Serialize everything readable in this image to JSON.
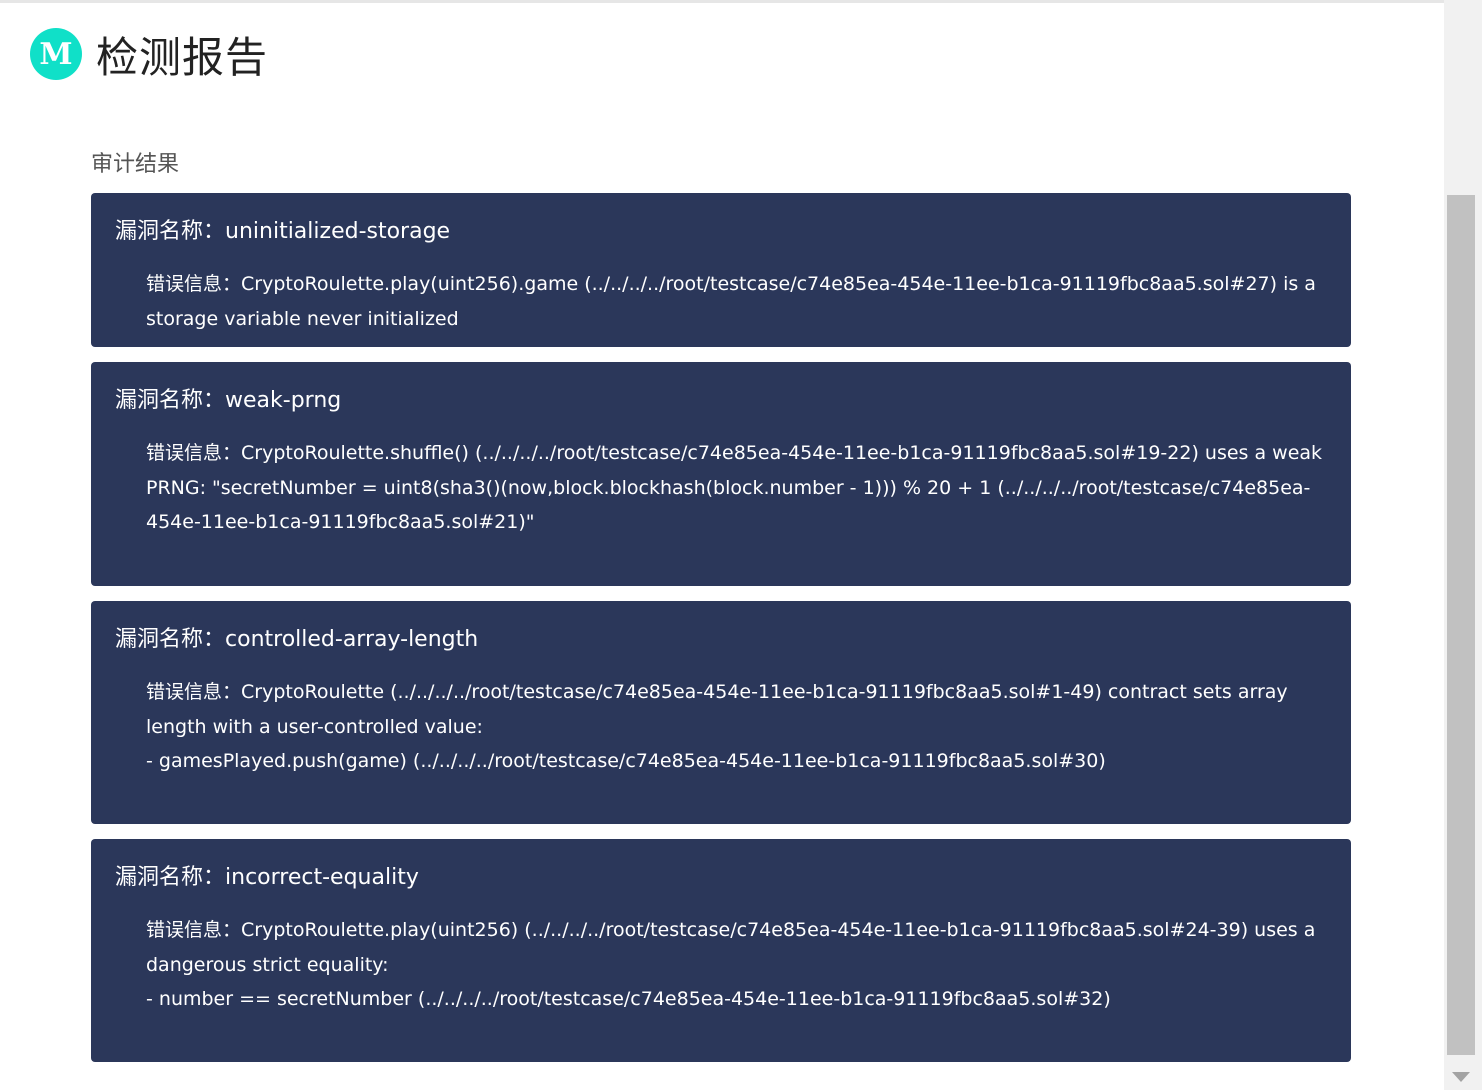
{
  "header": {
    "logo_letter": "M",
    "title": "检测报告"
  },
  "section": {
    "title": "审计结果"
  },
  "vulnerabilities": [
    {
      "name_label": "漏洞名称：",
      "name": "uninitialized-storage",
      "message_label": "错误信息：",
      "message": "CryptoRoulette.play(uint256).game (../../../../root/testcase/c74e85ea-454e-11ee-b1ca-91119fbc8aa5.sol#27) is a storage variable never initialized"
    },
    {
      "name_label": "漏洞名称：",
      "name": "weak-prng",
      "message_label": "错误信息：",
      "message": "CryptoRoulette.shuffle() (../../../../root/testcase/c74e85ea-454e-11ee-b1ca-91119fbc8aa5.sol#19-22) uses a weak PRNG: \"secretNumber = uint8(sha3()(now,block.blockhash(block.number - 1))) % 20 + 1 (../../../../root/testcase/c74e85ea-454e-11ee-b1ca-91119fbc8aa5.sol#21)\""
    },
    {
      "name_label": "漏洞名称：",
      "name": "controlled-array-length",
      "message_label": "错误信息：",
      "message": "CryptoRoulette (../../../../root/testcase/c74e85ea-454e-11ee-b1ca-91119fbc8aa5.sol#1-49) contract sets array length with a user-controlled value:\n- gamesPlayed.push(game) (../../../../root/testcase/c74e85ea-454e-11ee-b1ca-91119fbc8aa5.sol#30)"
    },
    {
      "name_label": "漏洞名称：",
      "name": "incorrect-equality",
      "message_label": "错误信息：",
      "message": "CryptoRoulette.play(uint256) (../../../../root/testcase/c74e85ea-454e-11ee-b1ca-91119fbc8aa5.sol#24-39) uses a dangerous strict equality:\n- number == secretNumber (../../../../root/testcase/c74e85ea-454e-11ee-b1ca-91119fbc8aa5.sol#32)"
    }
  ]
}
